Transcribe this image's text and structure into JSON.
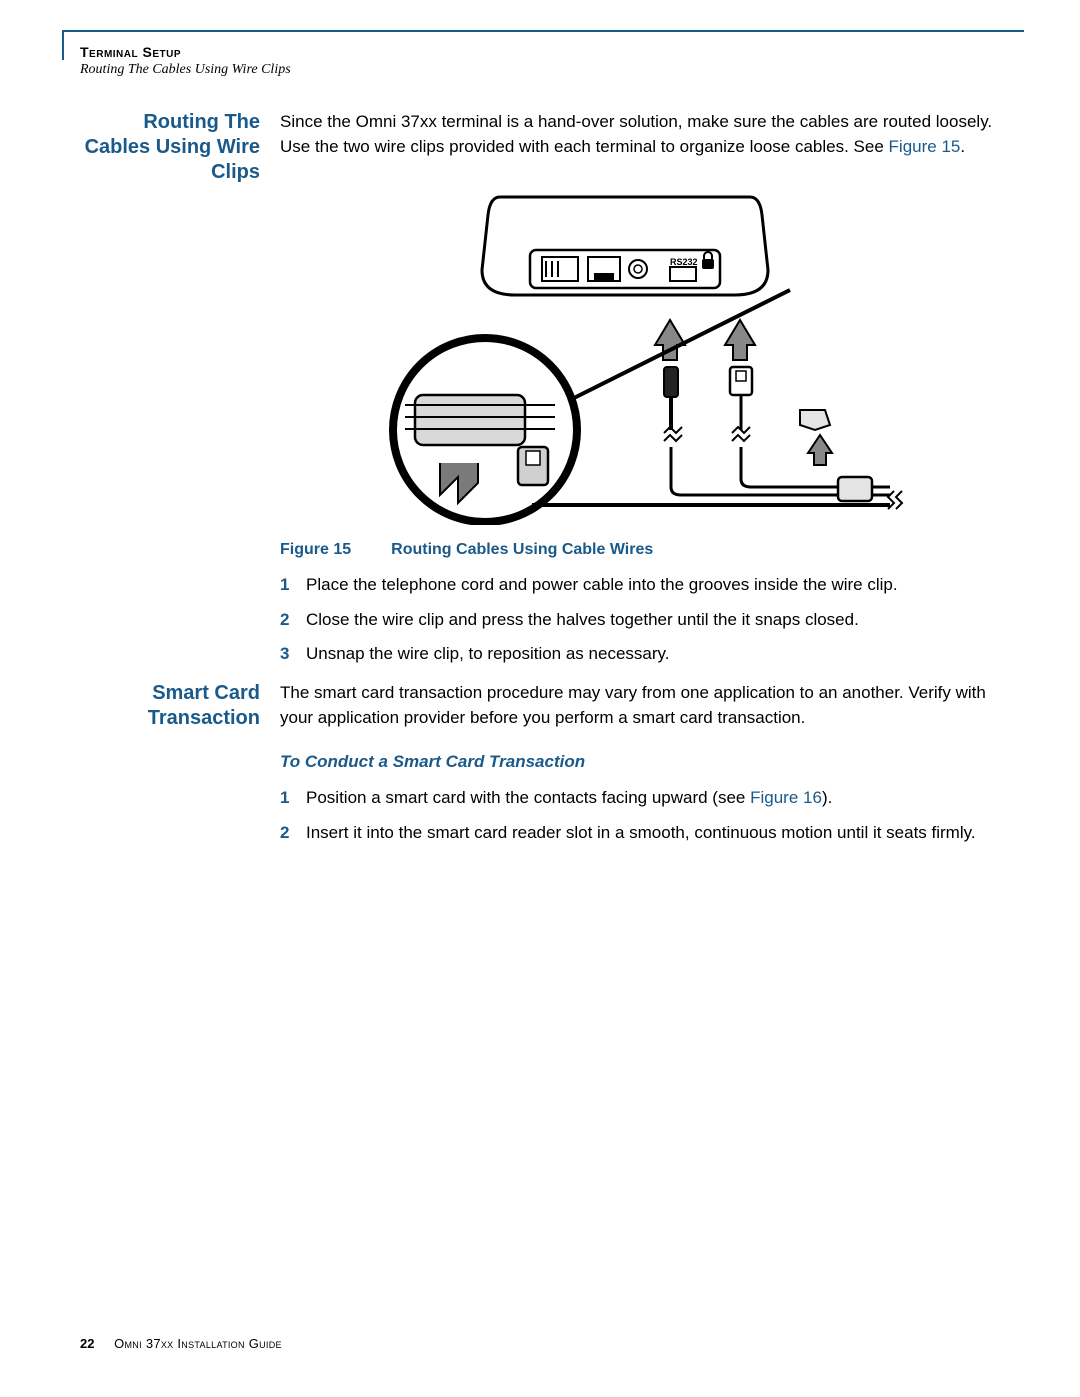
{
  "header": {
    "chapter": "Terminal Setup",
    "section": "Routing The Cables Using Wire Clips"
  },
  "section1": {
    "heading": "Routing The Cables Using Wire Clips",
    "intro_pre": "Since the Omni 37xx terminal is a hand-over solution, make sure the cables are routed loosely. Use the two wire clips provided with each terminal to organize loose cables. See ",
    "intro_xref": "Figure 15",
    "intro_post": "."
  },
  "figure": {
    "label": "Figure 15",
    "title": "Routing Cables Using Cable Wires",
    "port_label": "RS232"
  },
  "steps1": [
    {
      "n": "1",
      "text": "Place the telephone cord and power cable into the grooves inside the wire clip."
    },
    {
      "n": "2",
      "text": "Close the wire clip and press the halves together until the it snaps closed."
    },
    {
      "n": "3",
      "text": "Unsnap the wire clip, to reposition as necessary."
    }
  ],
  "section2": {
    "heading": "Smart Card Transaction",
    "intro": "The smart card transaction procedure may vary from one application to an another. Verify with your application provider before you perform a smart card transaction.",
    "subhead": "To Conduct a Smart Card Transaction"
  },
  "steps2": [
    {
      "n": "1",
      "pre": "Position a smart card with the contacts facing upward (see ",
      "xref": "Figure 16",
      "post": ")."
    },
    {
      "n": "2",
      "text": "Insert it into the smart card reader slot in a smooth, continuous motion until it seats firmly."
    }
  ],
  "footer": {
    "page": "22",
    "guide": "Omni 37xx Installation Guide"
  }
}
